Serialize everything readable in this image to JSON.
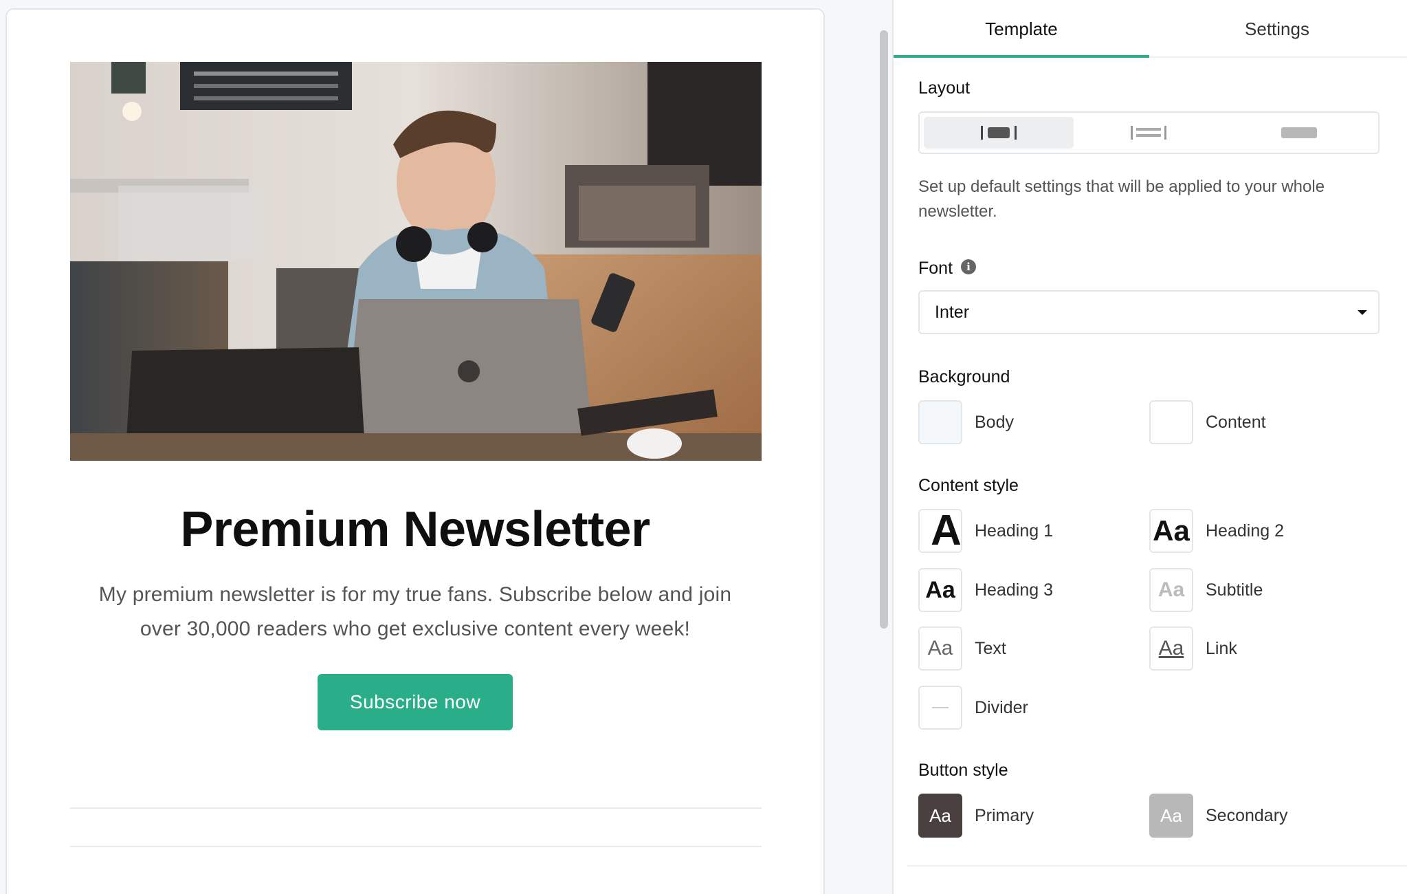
{
  "preview": {
    "headline": "Premium Newsletter",
    "lede": "My premium newsletter is for my true fans. Subscribe below and join over 30,000 readers who get exclusive content every week!",
    "cta_label": "Subscribe now",
    "accent_color": "#2aae8a"
  },
  "panel": {
    "tabs": [
      {
        "label": "Template",
        "active": true
      },
      {
        "label": "Settings",
        "active": false
      }
    ],
    "layout": {
      "label": "Layout",
      "options": [
        {
          "icon": "layout-centered-icon",
          "active": true
        },
        {
          "icon": "layout-wide-icon",
          "active": false
        },
        {
          "icon": "layout-full-icon",
          "active": false
        }
      ]
    },
    "description": "Set up default settings that will be applied to your whole newsletter.",
    "font": {
      "label": "Font",
      "info_icon": "i",
      "selected": "Inter"
    },
    "background": {
      "label": "Background",
      "items": [
        {
          "label": "Body",
          "color": "#f5f8fa"
        },
        {
          "label": "Content",
          "color": "#ffffff"
        }
      ]
    },
    "content_style": {
      "label": "Content style",
      "items": [
        {
          "label": "Heading 1",
          "glyph": "Aa"
        },
        {
          "label": "Heading 2",
          "glyph": "Aa"
        },
        {
          "label": "Heading 3",
          "glyph": "Aa"
        },
        {
          "label": "Subtitle",
          "glyph": "Aa"
        },
        {
          "label": "Text",
          "glyph": "Aa"
        },
        {
          "label": "Link",
          "glyph": "Aa"
        },
        {
          "label": "Divider"
        }
      ]
    },
    "button_style": {
      "label": "Button style",
      "items": [
        {
          "label": "Primary",
          "glyph": "Aa",
          "color": "#4a4040"
        },
        {
          "label": "Secondary",
          "glyph": "Aa",
          "color": "#b8b8b8"
        }
      ]
    }
  }
}
